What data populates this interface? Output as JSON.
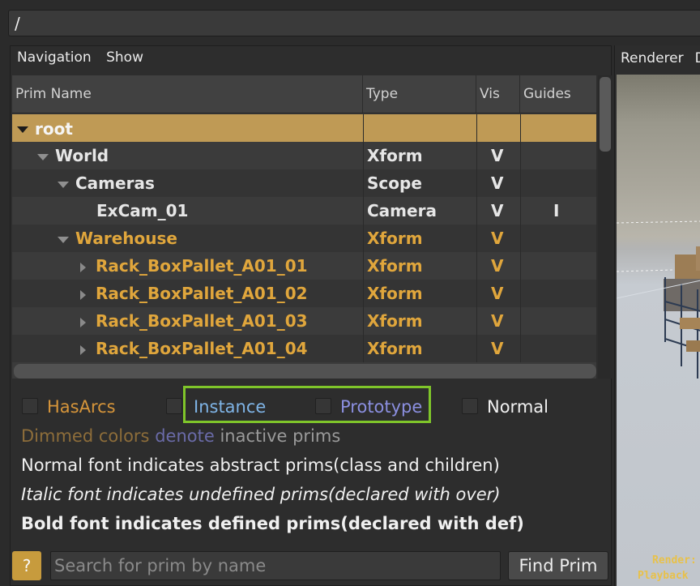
{
  "path_bar": {
    "value": "/"
  },
  "left_menu": {
    "items": [
      "Navigation",
      "Show"
    ]
  },
  "tree": {
    "columns": [
      "Prim Name",
      "Type",
      "Vis",
      "Guides"
    ],
    "rows": [
      {
        "name": "root",
        "type": "",
        "vis": "",
        "guides": ""
      },
      {
        "name": "World",
        "type": "Xform",
        "vis": "V",
        "guides": ""
      },
      {
        "name": "Cameras",
        "type": "Scope",
        "vis": "V",
        "guides": ""
      },
      {
        "name": "ExCam_01",
        "type": "Camera",
        "vis": "V",
        "guides": "I"
      },
      {
        "name": "Warehouse",
        "type": "Xform",
        "vis": "V",
        "guides": ""
      },
      {
        "name": "Rack_BoxPallet_A01_01",
        "type": "Xform",
        "vis": "V",
        "guides": ""
      },
      {
        "name": "Rack_BoxPallet_A01_02",
        "type": "Xform",
        "vis": "V",
        "guides": ""
      },
      {
        "name": "Rack_BoxPallet_A01_03",
        "type": "Xform",
        "vis": "V",
        "guides": ""
      },
      {
        "name": "Rack_BoxPallet_A01_04",
        "type": "Xform",
        "vis": "V",
        "guides": ""
      }
    ]
  },
  "legend": {
    "hasarcs": "HasArcs",
    "instance": "Instance",
    "prototype": "Prototype",
    "normal": "Normal",
    "colors": {
      "hasarcs": "#d6953a",
      "instance": "#7fb4e6",
      "prototype": "#8b8fe0",
      "normal": "#f0f0f0"
    }
  },
  "info": {
    "dimmed_1": "Dimmed colors",
    "dimmed_2": "denote",
    "dimmed_3": "inactive prims",
    "normal_font": "Normal font indicates abstract prims(class and children)",
    "italic_font": "Italic font indicates undefined prims(declared with over)",
    "bold_font": "Bold font indicates defined prims(declared with def)"
  },
  "search": {
    "help_label": "?",
    "placeholder": "Search for prim by name",
    "find_label": "Find Prim"
  },
  "right_menu": {
    "items": [
      "Renderer",
      "D"
    ]
  },
  "viewport": {
    "render_text": "Render:",
    "playback_text": "Playback"
  }
}
